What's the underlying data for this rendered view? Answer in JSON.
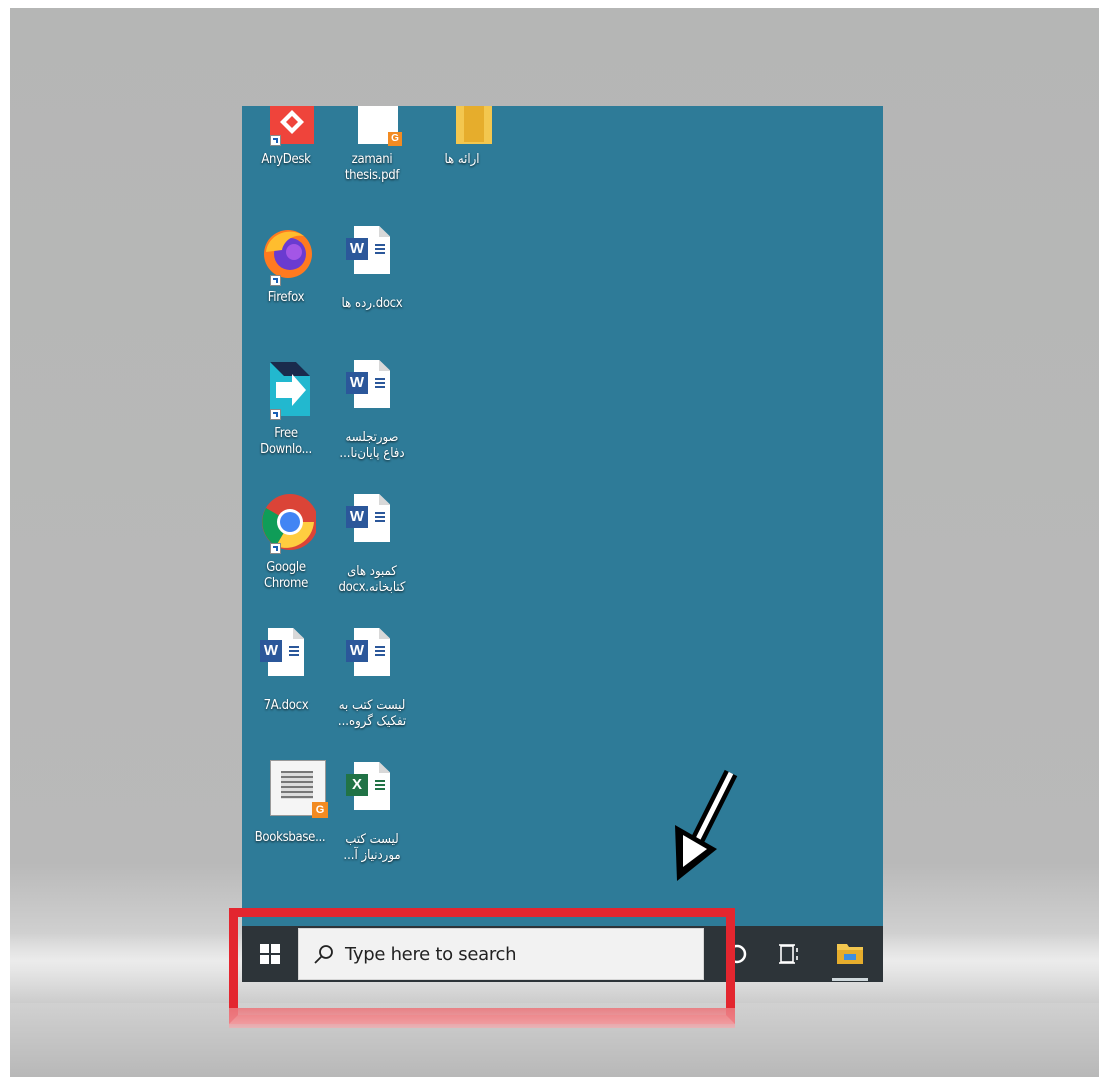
{
  "desktop": {
    "icons": [
      {
        "label": "AnyDesk",
        "type": "anydesk"
      },
      {
        "label": "zamani thesis.pdf",
        "type": "pdf"
      },
      {
        "label": "ارائه ها",
        "type": "folder"
      },
      {
        "label": "Firefox",
        "type": "firefox"
      },
      {
        "label": "رده ها.docx",
        "type": "word"
      },
      {
        "label": "Free Downlo...",
        "type": "fdm"
      },
      {
        "label": "صورتجلسه دفاع پایان‌نا...",
        "type": "word"
      },
      {
        "label": "Google Chrome",
        "type": "chrome"
      },
      {
        "label": "کمبود های کتابخانه.docx",
        "type": "word"
      },
      {
        "label": "7A.docx",
        "type": "word"
      },
      {
        "label": "لیست کتب به تفکیک گروه...",
        "type": "word"
      },
      {
        "label": "Booksbase...",
        "type": "pdf"
      },
      {
        "label": "لیست کتب موردنیاز آ...",
        "type": "excel"
      }
    ]
  },
  "taskbar": {
    "search_placeholder": "Type here to search",
    "start_icon": "windows-logo-icon",
    "cortana_icon": "cortana-circle-icon",
    "task_view_icon": "task-view-icon",
    "explorer_icon": "file-explorer-icon"
  },
  "annotation": {
    "highlight_color": "#e3262f",
    "arrow_color": "#000000"
  },
  "colors": {
    "desktop_bg": "#2e7b98",
    "taskbar_bg": "#2d3439",
    "search_bg": "#f2f2f2"
  }
}
